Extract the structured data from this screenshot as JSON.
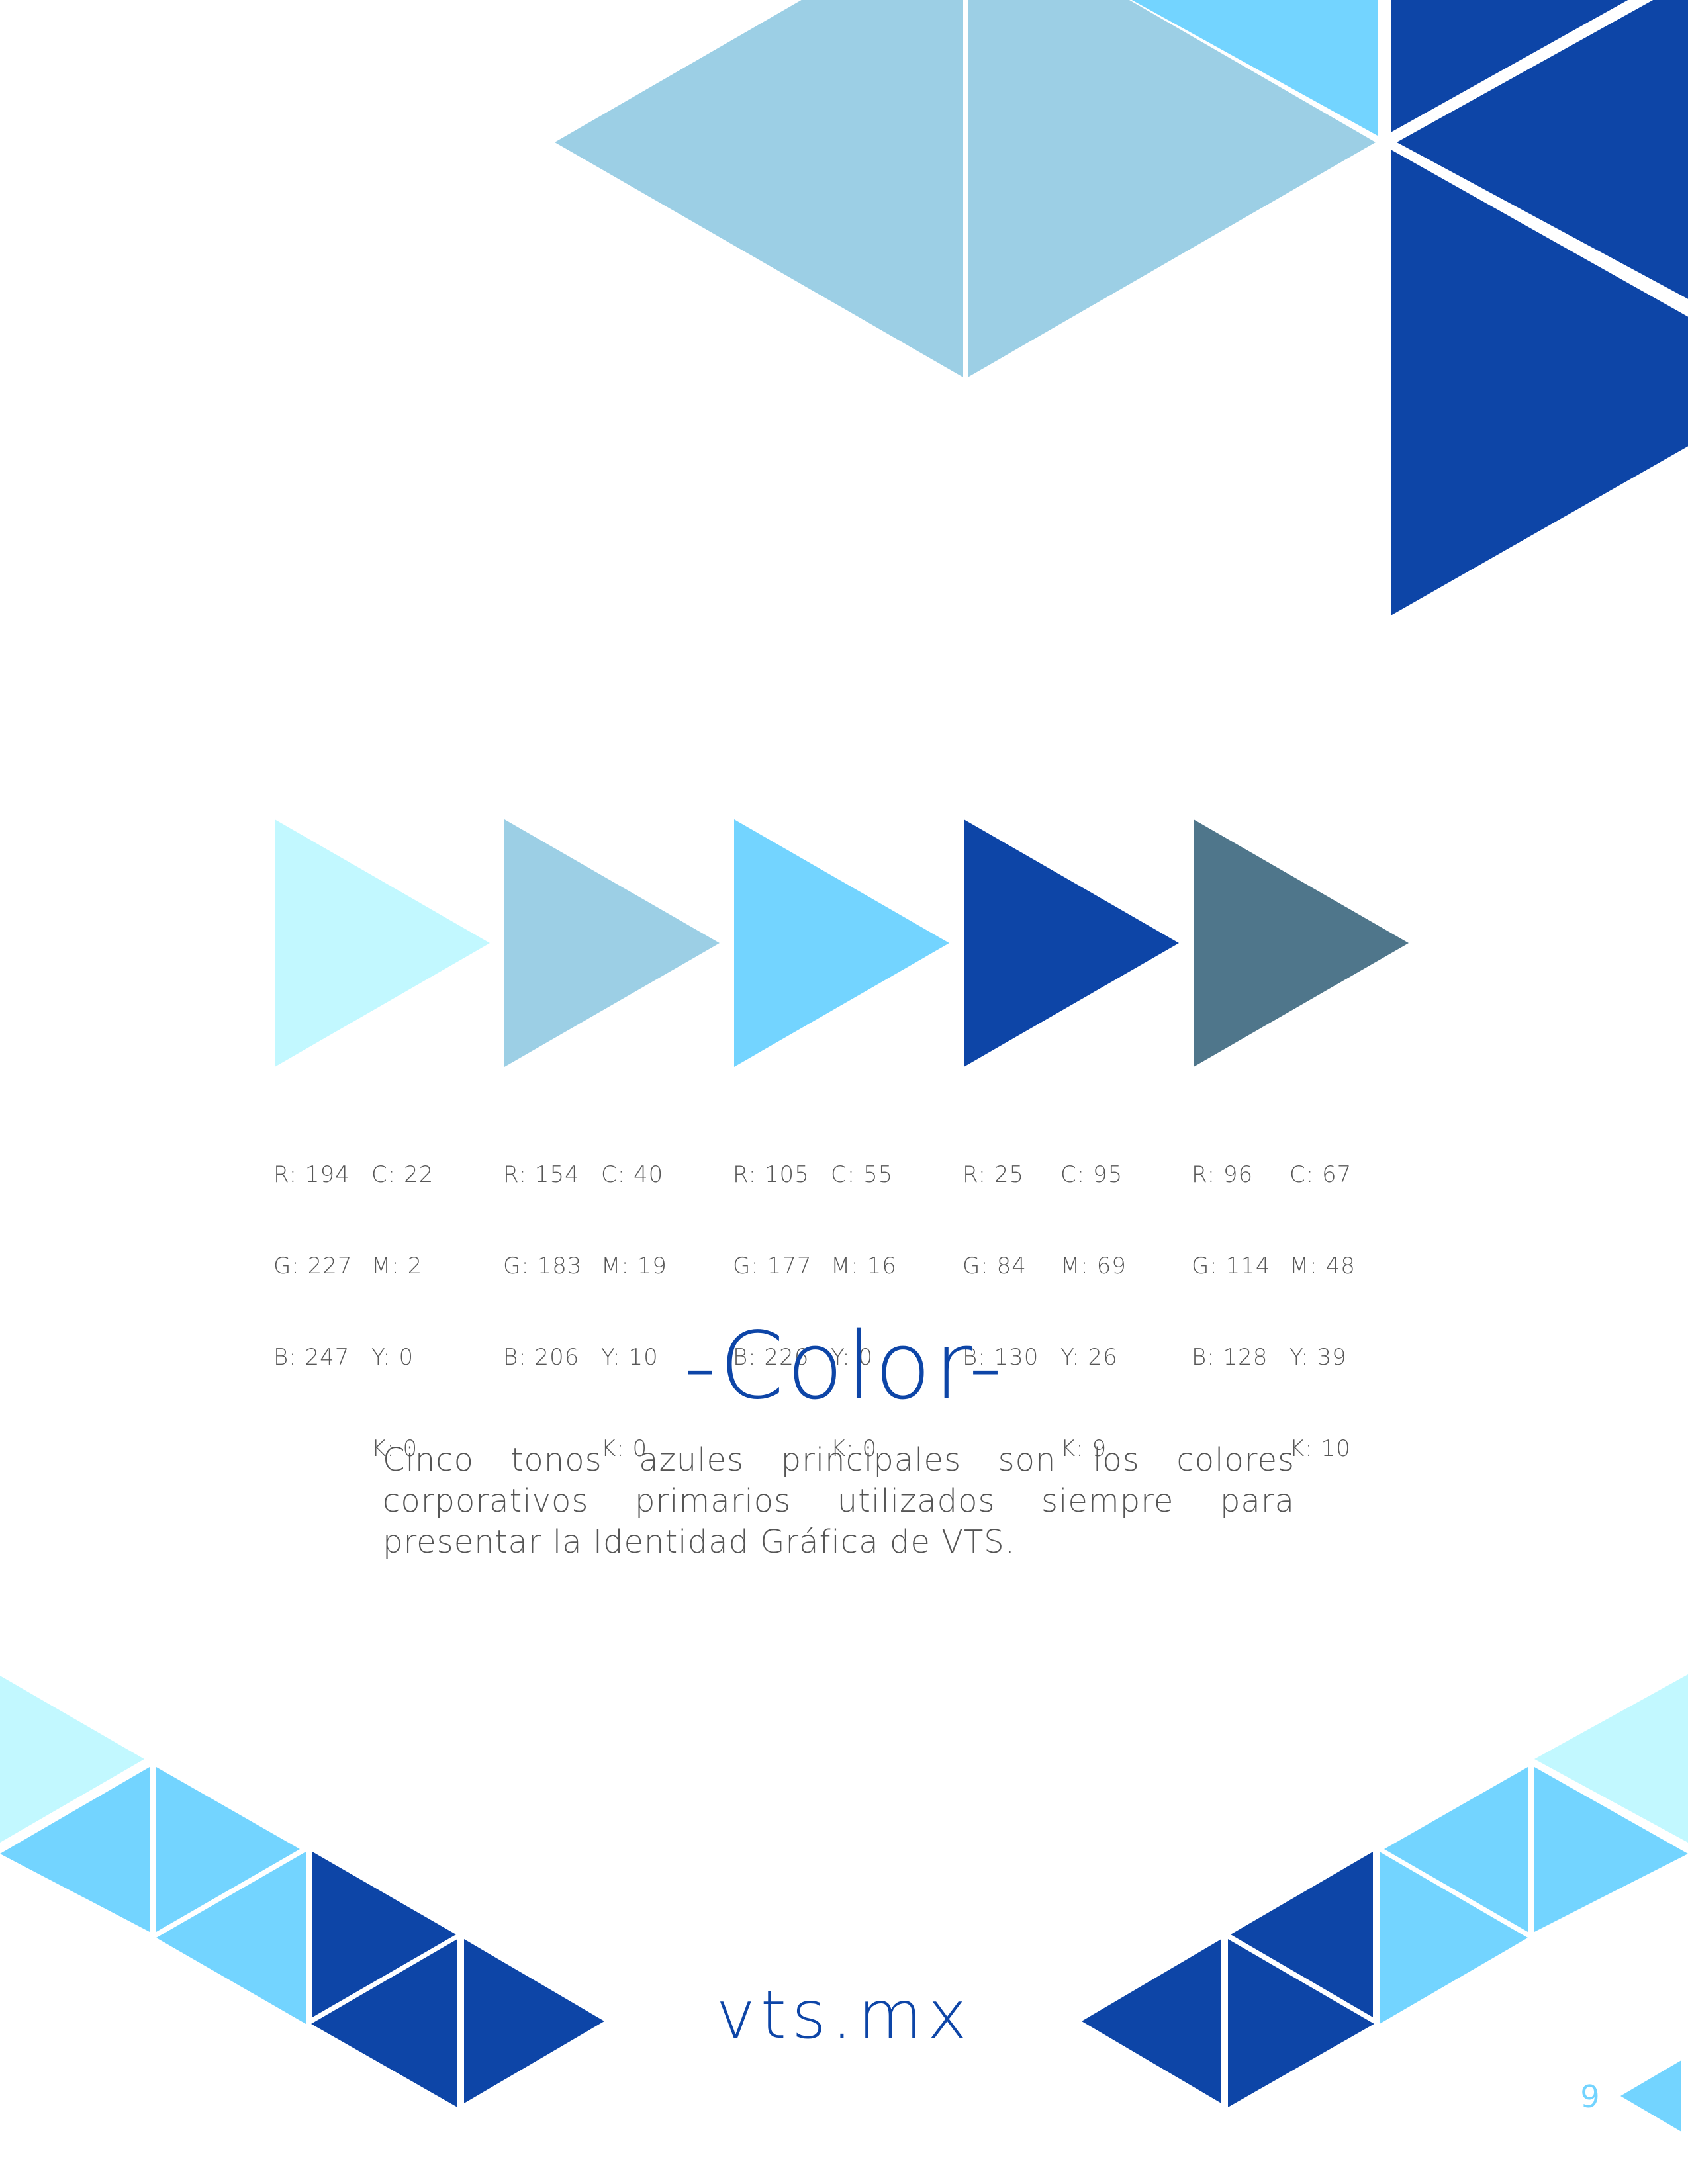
{
  "colors": {
    "lightest": "#c2f8ff",
    "light": "#9ccfe5",
    "sky": "#73d4ff",
    "royal": "#0d45a7",
    "slate": "#4f768b",
    "text_gray": "#555555"
  },
  "swatches": [
    {
      "color": "#c2f8ff",
      "rgb": [
        "R: 194",
        "G: 227",
        "B: 247"
      ],
      "cmyk": [
        "C: 22",
        "M: 2",
        "Y: 0",
        "K: 0"
      ]
    },
    {
      "color": "#9ccfe5",
      "rgb": [
        "R: 154",
        "G: 183",
        "B: 206"
      ],
      "cmyk": [
        "C: 40",
        "M: 19",
        "Y: 10",
        "K: 0"
      ]
    },
    {
      "color": "#73d4ff",
      "rgb": [
        "R: 105",
        "G: 177",
        "B: 226"
      ],
      "cmyk": [
        "C: 55",
        "M: 16",
        "Y: 0",
        "K: 0"
      ]
    },
    {
      "color": "#0d45a7",
      "rgb": [
        "R: 25",
        "G: 84",
        "B: 130"
      ],
      "cmyk": [
        "C: 95",
        "M: 69",
        "Y: 26",
        "K: 9"
      ]
    },
    {
      "color": "#4f768b",
      "rgb": [
        "R: 96",
        "G: 114",
        "B: 128"
      ],
      "cmyk": [
        "C: 67",
        "M: 48",
        "Y: 39",
        "K: 10"
      ]
    }
  ],
  "section": {
    "title": "-Color-",
    "description": "Cinco tonos azules principales son los colores corporativos primarios utilizados siempre para presentar la Identidad Gráfica de VTS."
  },
  "footer": {
    "website": "vts.mx",
    "page_number": "9"
  },
  "icons": {
    "page_marker": "triangle-right-icon"
  }
}
